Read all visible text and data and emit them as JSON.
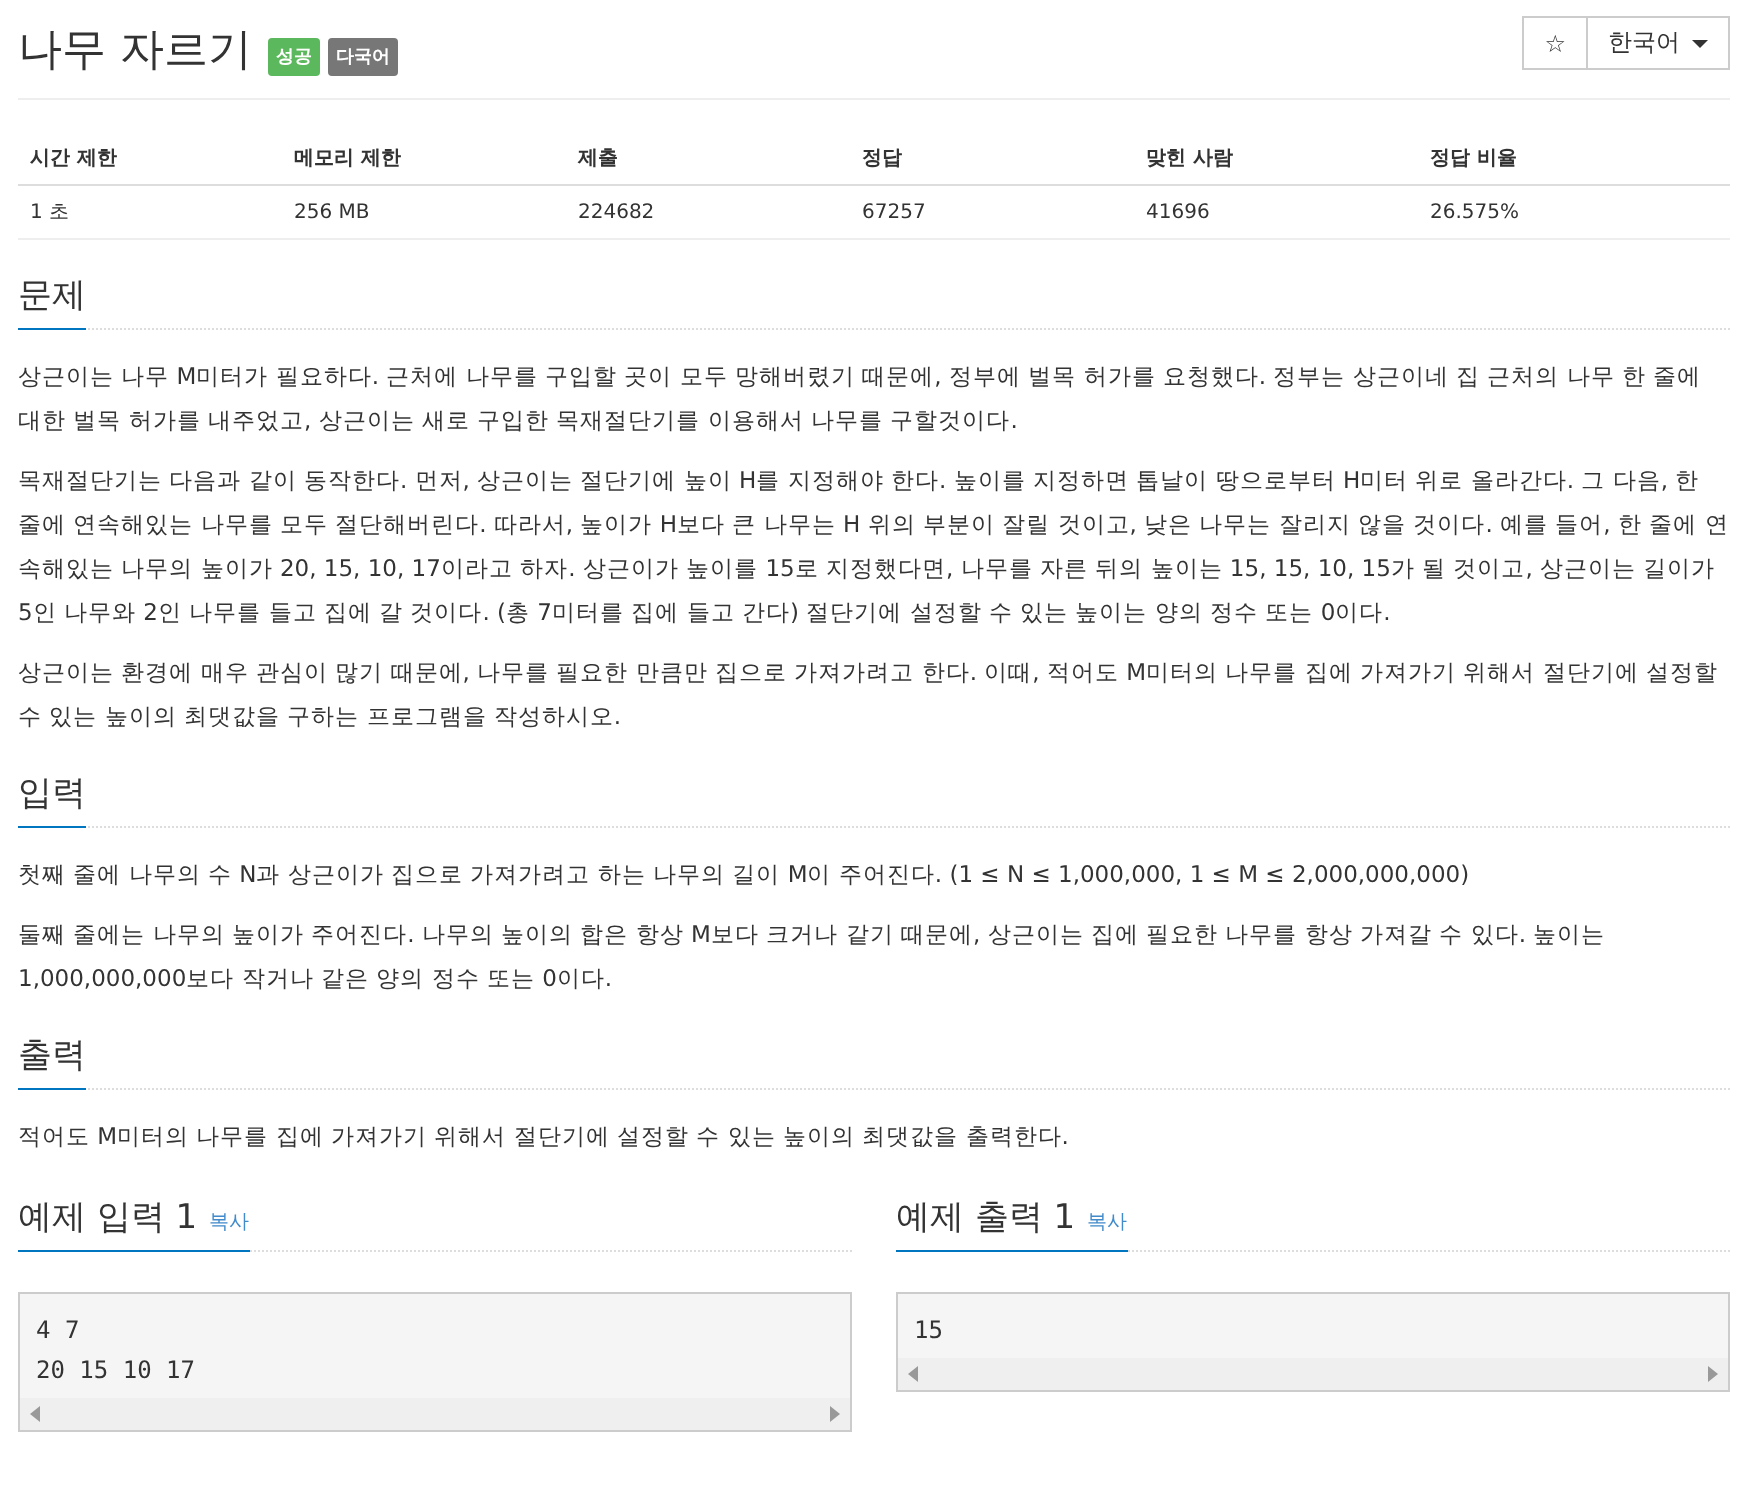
{
  "title": "나무 자르기",
  "badges": [
    {
      "label": "성공",
      "color": "#5cb85c"
    },
    {
      "label": "다국어",
      "color": "#777777"
    }
  ],
  "star_button": "☆",
  "language": "한국어",
  "info_table": {
    "columns": [
      "시간 제한",
      "메모리 제한",
      "제출",
      "정답",
      "맞힌 사람",
      "정답 비율"
    ],
    "rows": [
      [
        "1 초",
        "256 MB",
        "224682",
        "67257",
        "41696",
        "26.575%"
      ]
    ]
  },
  "sections": [
    {
      "heading": "문제",
      "paragraphs": [
        "상근이는 나무 M미터가 필요하다. 근처에 나무를 구입할 곳이 모두 망해버렸기 때문에, 정부에 벌목 허가를 요청했다. 정부는 상근이네 집 근처의 나무 한 줄에 대한 벌목 허가를 내주었고, 상근이는 새로 구입한 목재절단기를 이용해서 나무를 구할것이다.",
        "목재절단기는 다음과 같이 동작한다. 먼저, 상근이는 절단기에 높이 H를 지정해야 한다. 높이를 지정하면 톱날이 땅으로부터 H미터 위로 올라간다. 그 다음, 한 줄에 연속해있는 나무를 모두 절단해버린다. 따라서, 높이가 H보다 큰 나무는 H 위의 부분이 잘릴 것이고, 낮은 나무는 잘리지 않을 것이다. 예를 들어, 한 줄에 연속해있는 나무의 높이가 20, 15, 10, 17이라고 하자. 상근이가 높이를 15로 지정했다면, 나무를 자른 뒤의 높이는 15, 15, 10, 15가 될 것이고, 상근이는 길이가 5인 나무와 2인 나무를 들고 집에 갈 것이다. (총 7미터를 집에 들고 간다) 절단기에 설정할 수 있는 높이는 양의 정수 또는 0이다.",
        "상근이는 환경에 매우 관심이 많기 때문에, 나무를 필요한 만큼만 집으로 가져가려고 한다. 이때, 적어도 M미터의 나무를 집에 가져가기 위해서 절단기에 설정할 수 있는 높이의 최댓값을 구하는 프로그램을 작성하시오."
      ]
    },
    {
      "heading": "입력",
      "paragraphs": [
        "첫째 줄에 나무의 수 N과 상근이가 집으로 가져가려고 하는 나무의 길이 M이 주어진다. (1 ≤ N ≤ 1,000,000, 1 ≤ M ≤ 2,000,000,000)",
        "둘째 줄에는 나무의 높이가 주어진다. 나무의 높이의 합은 항상 M보다 크거나 같기 때문에, 상근이는 집에 필요한 나무를 항상 가져갈 수 있다. 높이는 1,000,000,000보다 작거나 같은 양의 정수 또는 0이다."
      ]
    },
    {
      "heading": "출력",
      "paragraphs": [
        "적어도 M미터의 나무를 집에 가져가기 위해서 절단기에 설정할 수 있는 높이의 최댓값을 출력한다."
      ]
    }
  ],
  "samples": [
    {
      "heading": "예제 입력 1",
      "copy": "복사",
      "lines": [
        "4 7",
        "20 15 10 17"
      ]
    },
    {
      "heading": "예제 출력 1",
      "copy": "복사",
      "lines": [
        "15"
      ]
    }
  ]
}
